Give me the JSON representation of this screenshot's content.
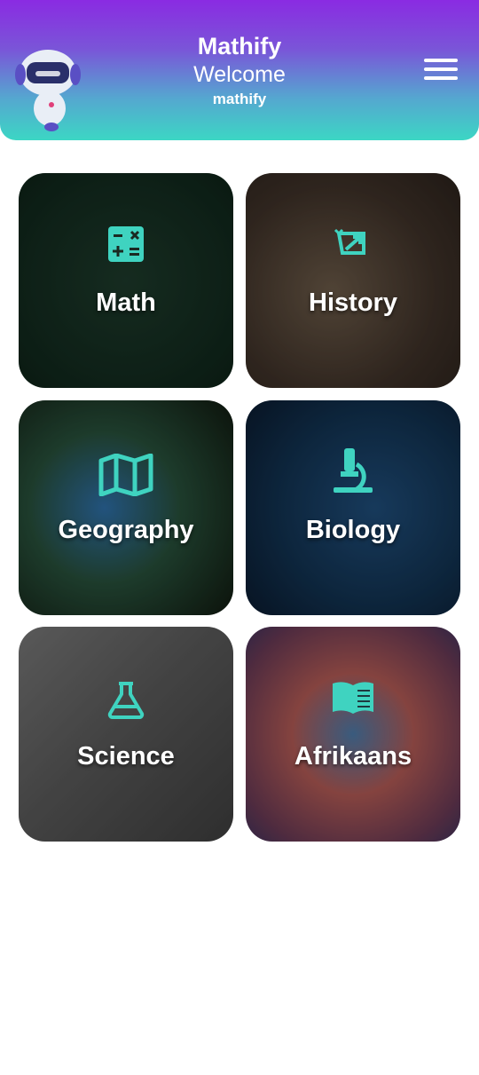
{
  "header": {
    "title": "Mathify",
    "welcome": "Welcome",
    "username": "mathify",
    "menu_icon": "hamburger-menu-icon",
    "mascot": "robot-mascot",
    "gradient_colors": [
      "#8a2be2",
      "#3cd6c4"
    ]
  },
  "subjects": [
    {
      "label": "Math",
      "icon": "calculator-icon"
    },
    {
      "label": "History",
      "icon": "scroll-icon"
    },
    {
      "label": "Geography",
      "icon": "map-icon"
    },
    {
      "label": "Biology",
      "icon": "microscope-icon"
    },
    {
      "label": "Science",
      "icon": "flask-icon"
    },
    {
      "label": "Afrikaans",
      "icon": "book-icon"
    }
  ],
  "accent_color": "#3fd3c0"
}
